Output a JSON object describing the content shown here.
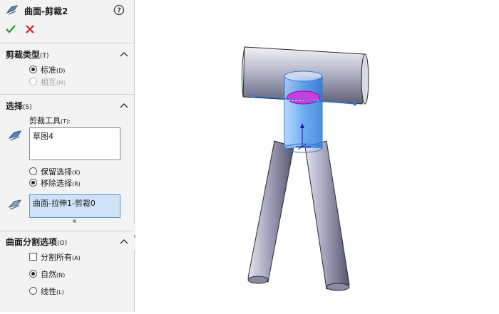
{
  "feature": {
    "title": "曲面-剪裁2",
    "help_icon": "help-icon",
    "ok_icon": "check-icon",
    "cancel_icon": "close-icon"
  },
  "trim_type": {
    "header": "剪裁类型",
    "header_key": "(T)",
    "options": [
      {
        "label": "标准",
        "key": "(D)",
        "selected": true,
        "enabled": true
      },
      {
        "label": "相互",
        "key": "(M)",
        "selected": false,
        "enabled": false
      }
    ]
  },
  "selections": {
    "header": "选择",
    "header_key": "(S)",
    "trim_tool_label": "剪裁工具",
    "trim_tool_key": "(T):",
    "trim_tool_value": "草图4",
    "keep_option": {
      "label": "保留选择",
      "key": "(K)",
      "selected": false
    },
    "remove_option": {
      "label": "移除选择",
      "key": "(R)",
      "selected": true
    },
    "pieces_value": "曲面-拉伸1-剪裁0"
  },
  "split_options": {
    "header": "曲面分割选项",
    "header_key": "(O)",
    "split_all": {
      "label": "分割所有",
      "key": "(A)",
      "checked": false
    },
    "natural": {
      "label": "自然",
      "key": "(N)",
      "selected": true
    },
    "linear": {
      "label": "线性",
      "key": "(L)",
      "selected": false
    }
  },
  "colors": {
    "accept": "#2e9e2e",
    "cancel": "#d02020",
    "selection_blue": "#3d8fe8",
    "trim_sketch": "#b020c8"
  }
}
